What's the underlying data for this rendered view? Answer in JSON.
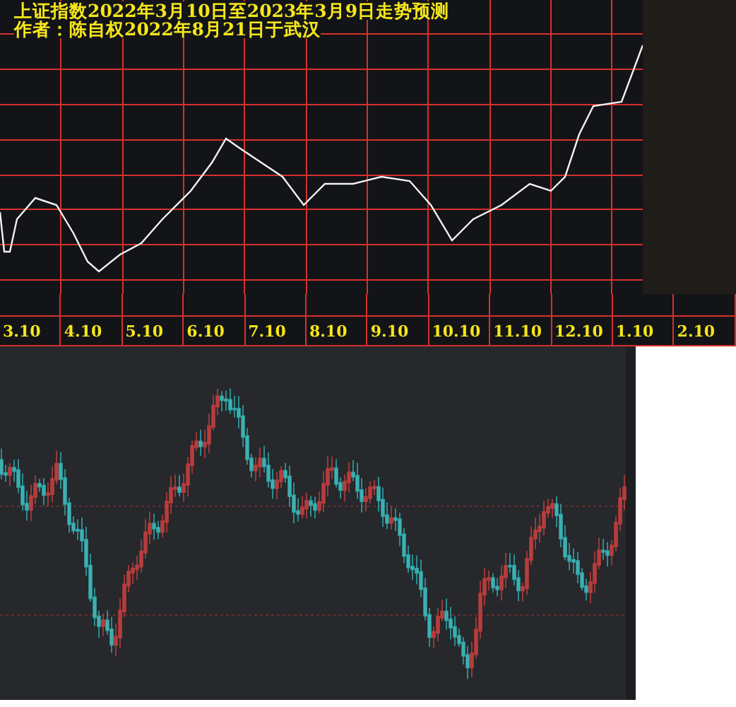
{
  "forecast_chart": {
    "title_lines": [
      "上证指数2022年3月10日至2023年3月9日走势预测",
      "作者：陈自权2022年8月21日于武汉"
    ],
    "x_labels": [
      "3.10",
      "4.10",
      "5.10",
      "6.10",
      "7.10",
      "8.10",
      "9.10",
      "10.10",
      "11.10",
      "12.10",
      "1.10",
      "2.10"
    ]
  }
}
